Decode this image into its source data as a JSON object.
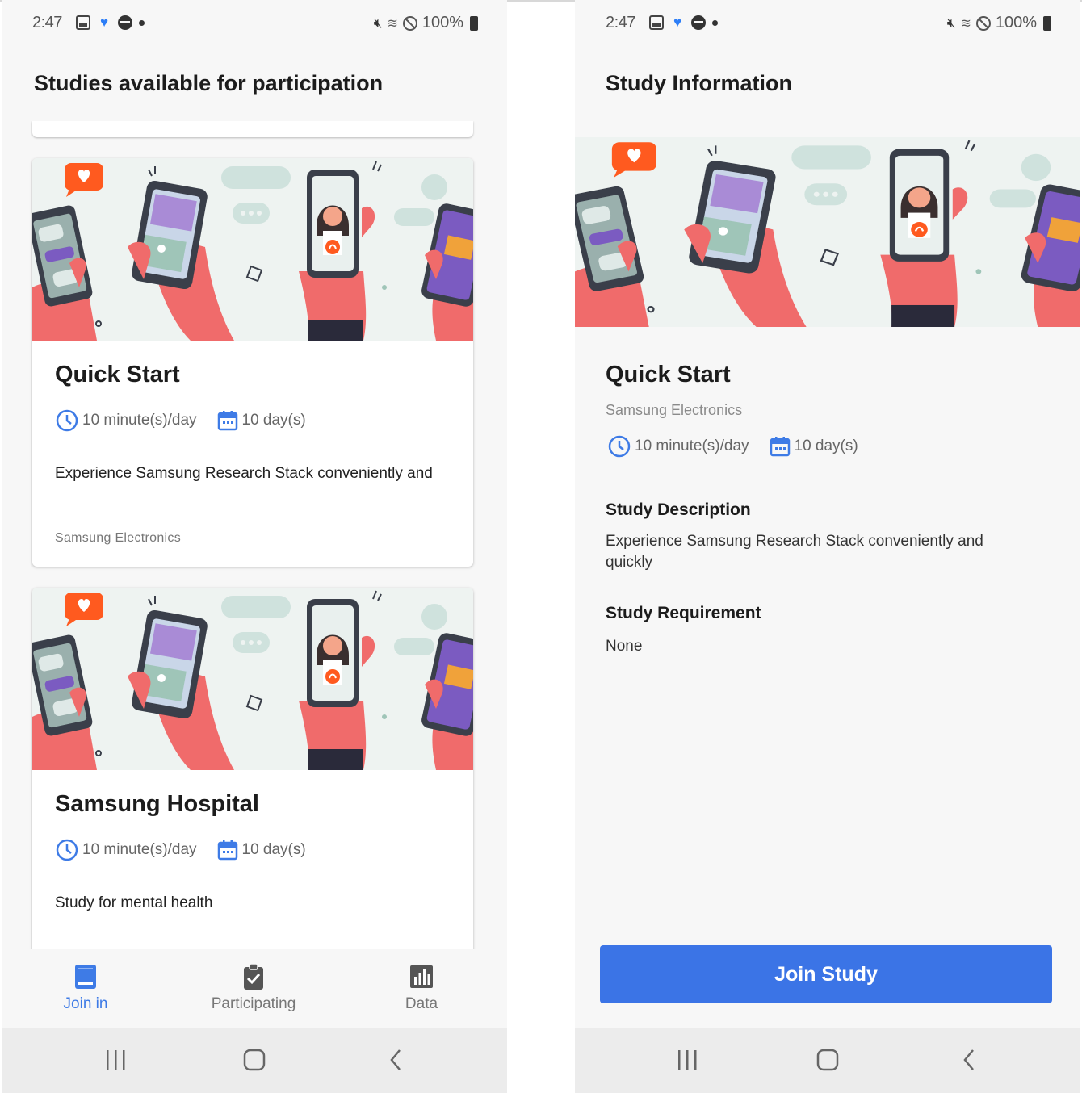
{
  "colors": {
    "accent": "#3b74e6",
    "active_nav": "#3e7be6",
    "illustration_bg": "#eef3f1",
    "hand": "#f06b6b",
    "heart_bubble": "#ff5a1f",
    "phone_screen_purple": "#7b5bc1"
  },
  "status_bar": {
    "time": "2:47",
    "battery": "100%",
    "icons": [
      "gallery-icon",
      "heart-app-icon",
      "messenger-icon",
      "dot-icon",
      "mute-icon",
      "wifi-icon",
      "do-not-disturb-icon",
      "battery-icon"
    ]
  },
  "list_screen": {
    "title": "Studies available for participation",
    "studies": [
      {
        "title": "Quick Start",
        "duration_per_day": "10 minute(s)/day",
        "period": "10 day(s)",
        "description": "Experience Samsung Research Stack conveniently and",
        "organization": "Samsung Electronics"
      },
      {
        "title": "Samsung Hospital",
        "duration_per_day": "10 minute(s)/day",
        "period": "10 day(s)",
        "description": "Study for mental health"
      }
    ],
    "bottom_nav": [
      {
        "label": "Join in",
        "icon": "book-icon",
        "active": true
      },
      {
        "label": "Participating",
        "icon": "clipboard-check-icon",
        "active": false
      },
      {
        "label": "Data",
        "icon": "bar-chart-icon",
        "active": false
      }
    ]
  },
  "detail_screen": {
    "title": "Study Information",
    "study_title": "Quick Start",
    "organization": "Samsung Electronics",
    "duration_per_day": "10 minute(s)/day",
    "period": "10 day(s)",
    "description_heading": "Study Description",
    "description": "Experience Samsung Research Stack conveniently and quickly",
    "requirement_heading": "Study Requirement",
    "requirement": "None",
    "join_button": "Join Study"
  },
  "system_nav": [
    "recents-icon",
    "home-icon",
    "back-icon"
  ]
}
